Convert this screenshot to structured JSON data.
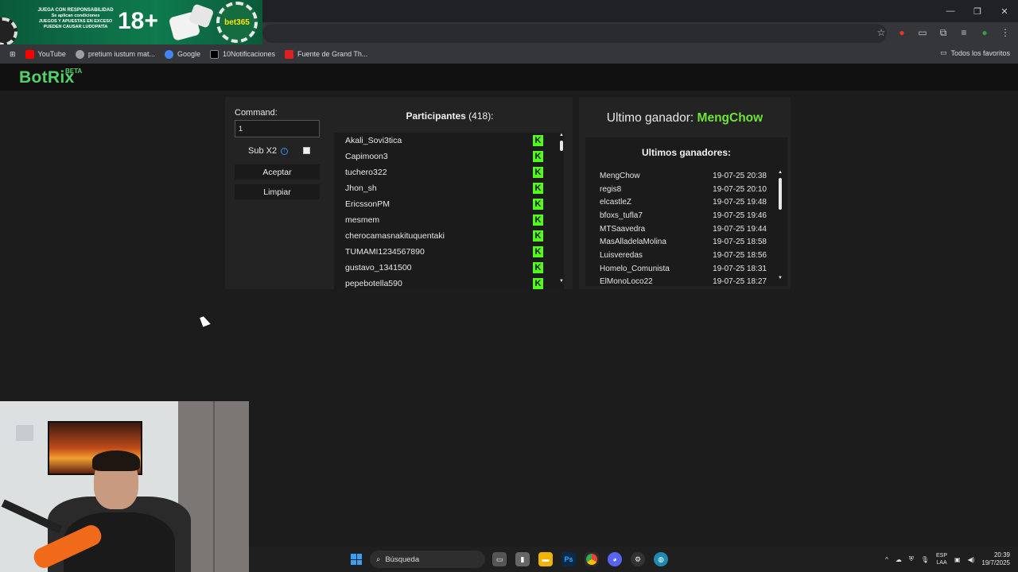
{
  "ad": {
    "line1": "JUEGA CON RESPONSABILIDAD",
    "line2": "Se aplican condiciones",
    "line3": "JUEGOS Y APUESTAS EN EXCESO",
    "line4": "PUEDEN CAUSAR LUDOPATÍA",
    "age": "18+",
    "brand": "bet365"
  },
  "browser": {
    "bookmarks": [
      {
        "label": "YouTube",
        "color": "#ff0000"
      },
      {
        "label": "pretium iustum mat...",
        "color": "#9aa0a6"
      },
      {
        "label": "Google",
        "color": "#4285f4"
      },
      {
        "label": "10Notificaciones",
        "color": "#000000"
      },
      {
        "label": "Fuente de Grand Th...",
        "color": "#e02020"
      }
    ],
    "all_bookmarks": "Todos los favoritos"
  },
  "app": {
    "logo": "BotRix",
    "beta": "BETA"
  },
  "command": {
    "label": "Command:",
    "value": "1",
    "subx2_label": "Sub X2",
    "subx2_checked": false,
    "accept_label": "Aceptar",
    "clear_label": "Limpiar"
  },
  "participants": {
    "title": "Participantes",
    "count": "(418):",
    "items": [
      "Akali_Sovi3tica",
      "Capimoon3",
      "tuchero322",
      "Jhon_sh",
      "EricssonPM",
      "mesmem",
      "cherocamasnakituquentaki",
      "TUMAMI1234567890",
      "gustavo_1341500",
      "pepebotella590"
    ],
    "platform_icon": "kick-icon"
  },
  "winners": {
    "last_label": "Ultimo ganador:",
    "last_name": "MengChow",
    "list_title": "Ultimos ganadores:",
    "items": [
      {
        "name": "MengChow",
        "time": "19-07-25 20:38"
      },
      {
        "name": "regis8",
        "time": "19-07-25 20:10"
      },
      {
        "name": "elcastleZ",
        "time": "19-07-25 19:48"
      },
      {
        "name": "bfoxs_tufla7",
        "time": "19-07-25 19:46"
      },
      {
        "name": "MTSaavedra",
        "time": "19-07-25 19:44"
      },
      {
        "name": "MasAlladelaMolina",
        "time": "19-07-25 18:58"
      },
      {
        "name": "Luisveredas",
        "time": "19-07-25 18:56"
      },
      {
        "name": "Homelo_Comunista",
        "time": "19-07-25 18:31"
      },
      {
        "name": "ElMonoLoco22",
        "time": "19-07-25 18:27"
      }
    ]
  },
  "taskbar": {
    "search_placeholder": "Búsqueda",
    "lang_line1": "ESP",
    "lang_line2": "LAA",
    "time": "20:39",
    "date": "19/7/2025"
  },
  "colors": {
    "accent_green": "#53d26c",
    "kick_green": "#53fc18",
    "winner_green": "#6fe33a",
    "panel": "#232323",
    "background": "#1c1c1c"
  }
}
